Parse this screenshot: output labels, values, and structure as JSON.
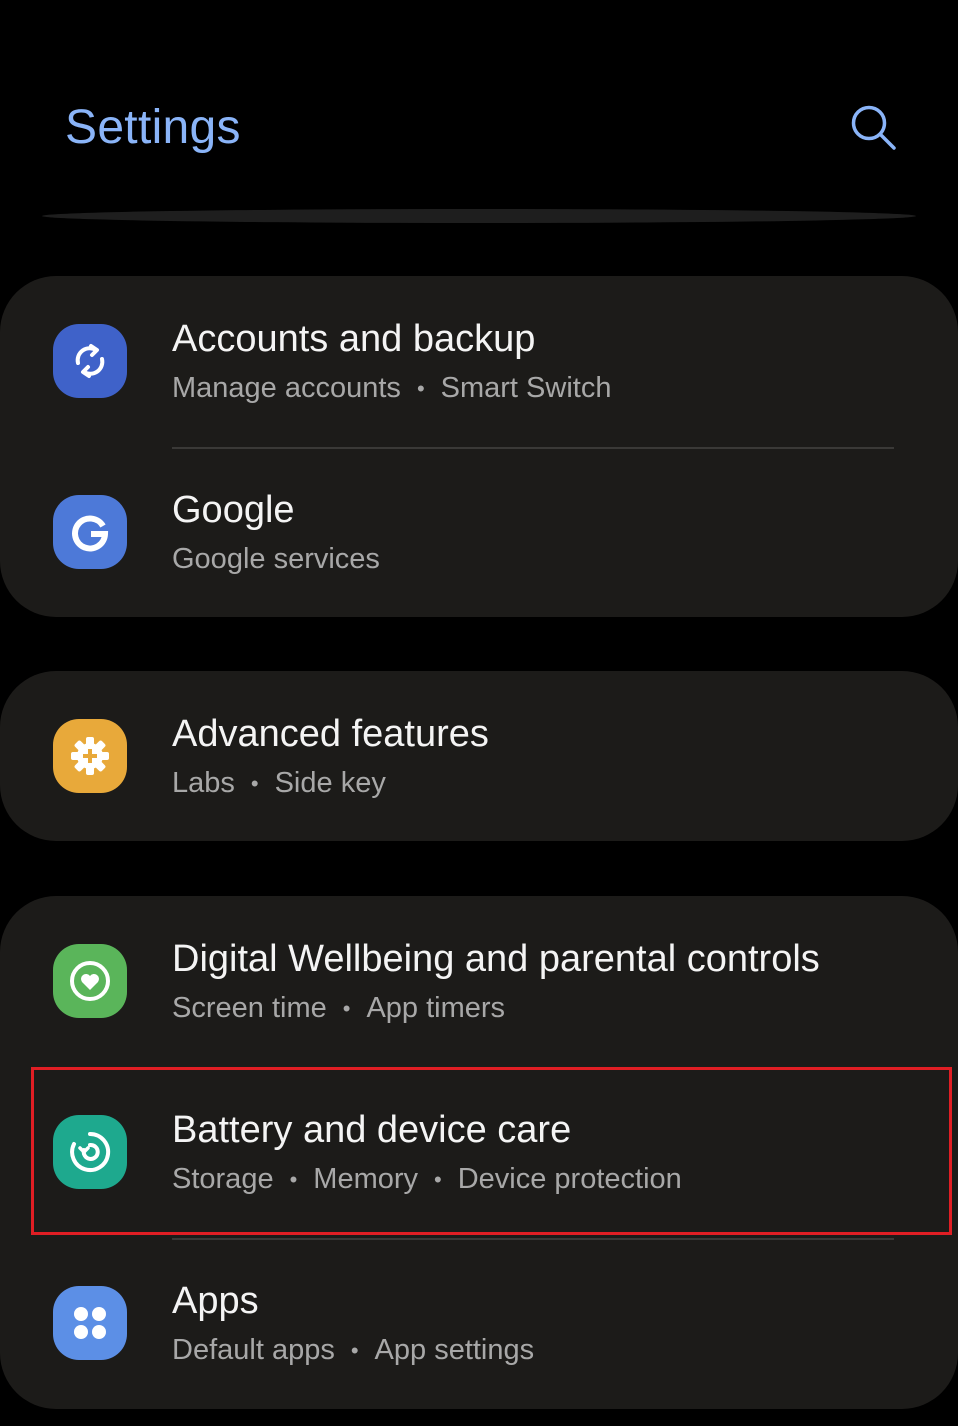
{
  "header": {
    "title": "Settings",
    "search_icon": "search-icon"
  },
  "colors": {
    "title": "#8ab4f8",
    "card_bg": "#1c1b19",
    "highlight": "#e01e24",
    "accounts_icon_bg": "#3f62c9",
    "google_icon_bg": "#4d79d8",
    "advanced_icon_bg": "#e8a93a",
    "wellbeing_icon_bg": "#5ab55a",
    "battery_icon_bg": "#1ea98e",
    "apps_icon_bg": "#5c8fe6"
  },
  "groups": [
    {
      "items": [
        {
          "title": "Accounts and backup",
          "subtitle": [
            "Manage accounts",
            "Smart Switch"
          ],
          "icon": "sync-icon"
        },
        {
          "title": "Google",
          "subtitle": [
            "Google services"
          ],
          "icon": "google-icon"
        }
      ]
    },
    {
      "items": [
        {
          "title": "Advanced features",
          "subtitle": [
            "Labs",
            "Side key"
          ],
          "icon": "gear-plus-icon"
        }
      ]
    },
    {
      "items": [
        {
          "title": "Digital Wellbeing and parental controls",
          "subtitle": [
            "Screen time",
            "App timers"
          ],
          "icon": "wellbeing-icon"
        },
        {
          "title": "Battery and device care",
          "subtitle": [
            "Storage",
            "Memory",
            "Device protection"
          ],
          "icon": "device-care-icon",
          "highlighted": true
        },
        {
          "title": "Apps",
          "subtitle": [
            "Default apps",
            "App settings"
          ],
          "icon": "apps-grid-icon"
        }
      ]
    }
  ]
}
